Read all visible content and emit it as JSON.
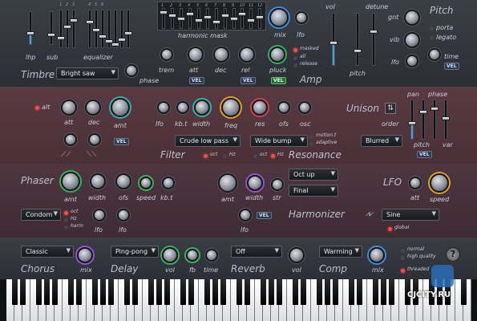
{
  "timbre": {
    "section_label": "Timbre",
    "lhp": "lhp",
    "sub": "sub",
    "equalizer": "equalizer",
    "eq_numbers": [
      "1",
      "2",
      "3",
      "4",
      "5",
      "6"
    ],
    "harmonic_numbers": [
      "1",
      "2",
      "3",
      "4",
      "5",
      "6",
      "7",
      "8",
      "9",
      "10",
      "11",
      "12"
    ],
    "harmonic_mask": "harmonic mask",
    "mix": "mix",
    "lfo": "lfo",
    "timbre_dropdown": "Bright saw",
    "phase": "phase",
    "trem": "trem",
    "att": "att",
    "dec": "dec",
    "rel": "rel",
    "pluck": "pluck",
    "vel1": "VEL",
    "vel2": "VEL",
    "vel3": "VEL",
    "masked": "masked",
    "all": "all",
    "release": "release",
    "amp": "Amp",
    "vol": "vol",
    "detune": "detune",
    "pitch_small": "pitch",
    "pitch_title": "Pitch",
    "gnt": "gnt",
    "vib": "vib",
    "lfo2": "lfo",
    "porta": "porta",
    "legato": "legato",
    "time": "time",
    "vel_pitch": "VEL"
  },
  "filter": {
    "alt": "alt",
    "att": "att",
    "dec": "dec",
    "amt": "amt",
    "vel": "VEL",
    "lfo": "lfo",
    "kbt": "kb.t",
    "width": "width",
    "freq": "freq",
    "res": "res",
    "ofs": "ofs",
    "osc": "osc",
    "unison": "Unison",
    "order": "order",
    "pan": "pan",
    "phase": "phase",
    "pitch": "pitch",
    "var": "var",
    "vel_unison": "VEL",
    "filter_title": "Filter",
    "filter_dropdown": "Crude low pass",
    "resonance_dropdown": "Wide bump",
    "resonance_title": "Resonance",
    "motion": "motion.t",
    "adaptive": "adaptive",
    "oct1": "oct",
    "hz1": "Hz",
    "oct2": "oct",
    "hz2": "Hz",
    "unison_dropdown": "Blurred"
  },
  "phaser": {
    "title": "Phaser",
    "amt": "amt",
    "width": "width",
    "ofs": "ofs",
    "speed": "speed",
    "kbt": "kb.t",
    "dropdown": "Condom",
    "oct": "oct",
    "hz": "Hz",
    "harm": "harm",
    "lfo1": "lfo",
    "lfo2": "lfo",
    "h_amt": "amt",
    "h_width": "width",
    "h_str": "str",
    "octup": "Oct up",
    "final": "Final",
    "harmonizer": "Harmonizer",
    "h_vel": "VEL",
    "h_lfo": "lfo",
    "lfo_title": "LFO",
    "att": "att",
    "speed2": "speed",
    "lfo_dropdown": "Sine",
    "global": "global"
  },
  "fx": {
    "chorus_dd": "Classic",
    "chorus": "Chorus",
    "chorus_mix": "mix",
    "delay_dd": "Ping-pong",
    "delay": "Delay",
    "delay_vol": "vol",
    "fb": "fb",
    "time": "time",
    "reverb_dd": "Off",
    "reverb": "Reverb",
    "reverb_vol": "vol",
    "comp_dd": "Warming",
    "comp": "Comp",
    "comp_mix": "mix",
    "normal": "normal",
    "high_quality": "high quality",
    "threaded": "threaded",
    "help": "?"
  },
  "watermark": "CJCITY.RU",
  "colors": {
    "teal": "#2fb7a8",
    "red": "#d0415a",
    "purple": "#9a4fd6",
    "blue": "#3c8fe0",
    "green": "#36b25a",
    "orange": "#e8a020"
  }
}
